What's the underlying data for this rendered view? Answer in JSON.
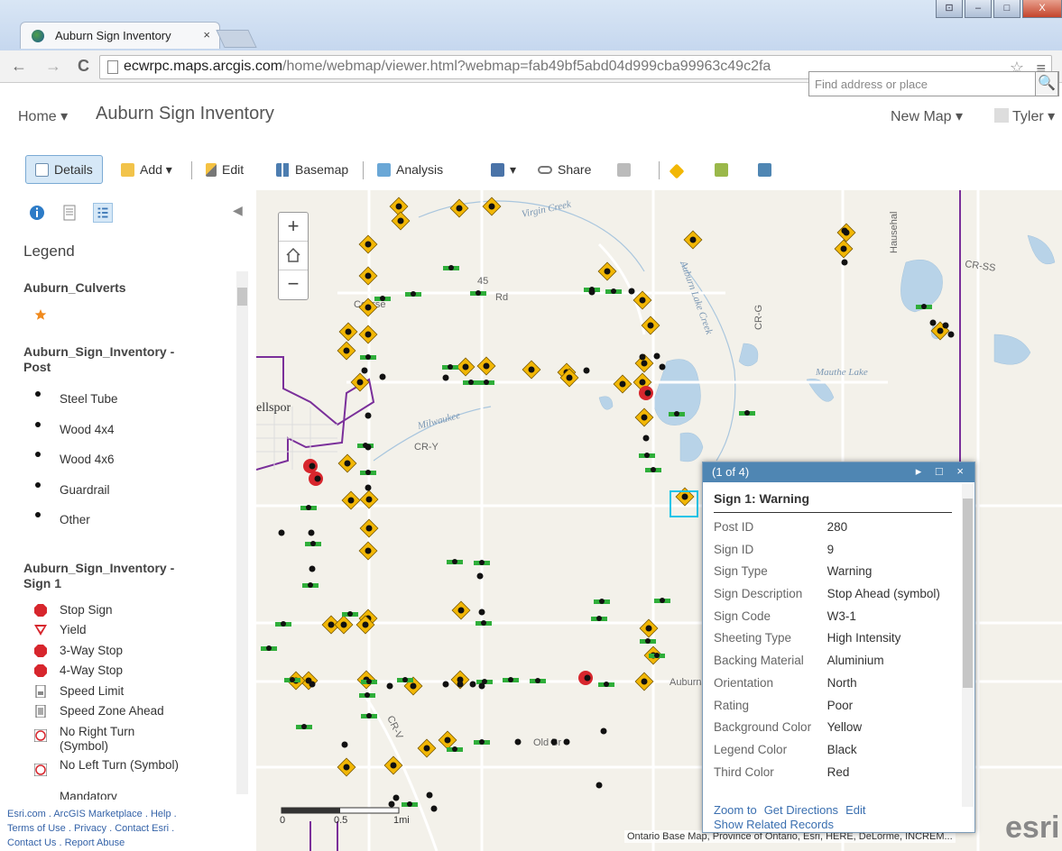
{
  "browser": {
    "tab_title": "Auburn Sign Inventory",
    "tab_close": "×",
    "url_host": "ecwrpc.maps.arcgis.com",
    "url_path": "/home/webmap/viewer.html?webmap=fab49bf5abd04d999cba99963c49c2fa",
    "back": "←",
    "forward": "→",
    "reload": "C",
    "star": "☆",
    "menu": "≡",
    "window_controls": [
      "⊡",
      "–",
      "□",
      "X"
    ]
  },
  "header": {
    "home_label": "Home ▾",
    "map_title": "Auburn Sign Inventory",
    "new_map_label": "New Map ▾",
    "user_label": "Tyler ▾"
  },
  "toolbar": {
    "details": "Details",
    "add": "Add ▾",
    "edit": "Edit",
    "basemap": "Basemap",
    "analysis": "Analysis",
    "save_caret": "▾",
    "share": "Share",
    "search_placeholder": "Find address or place",
    "search_button": "🔍"
  },
  "sidebar": {
    "collapse": "◀",
    "legend_title": "Legend",
    "layers": [
      {
        "name": "Auburn_Culverts",
        "items": [
          {
            "label": "",
            "symbol": "culvert-star"
          }
        ]
      },
      {
        "name": "Auburn_Sign_Inventory - Post",
        "items": [
          {
            "label": "Steel Tube",
            "symbol": "dot"
          },
          {
            "label": "Wood 4x4",
            "symbol": "dot"
          },
          {
            "label": "Wood 4x6",
            "symbol": "dot"
          },
          {
            "label": "Guardrail",
            "symbol": "dot"
          },
          {
            "label": "Other",
            "symbol": "dot"
          }
        ]
      },
      {
        "name": "Auburn_Sign_Inventory - Sign 1",
        "items": [
          {
            "label": "Stop Sign",
            "symbol": "stop"
          },
          {
            "label": "Yield",
            "symbol": "yield"
          },
          {
            "label": "3-Way Stop",
            "symbol": "stop"
          },
          {
            "label": "4-Way Stop",
            "symbol": "stop"
          },
          {
            "label": "Speed Limit",
            "symbol": "speed-limit"
          },
          {
            "label": "Speed Zone Ahead",
            "symbol": "speed-zone"
          },
          {
            "label": "No Right Turn (Symbol)",
            "symbol": "no-right-turn"
          },
          {
            "label": "No Left Turn (Symbol)",
            "symbol": "no-left-turn"
          },
          {
            "label": "Mandatory",
            "symbol": "mandatory"
          }
        ]
      }
    ],
    "footer": {
      "line1": [
        "Esri.com",
        "ArcGIS Marketplace",
        "Help"
      ],
      "line2": [
        "Terms of Use",
        "Privacy",
        "Contact Esri"
      ],
      "line3": [
        "Contact Us",
        "Report Abuse"
      ]
    }
  },
  "map": {
    "zoom_in": "+",
    "zoom_out": "−",
    "scale_labels": [
      "0",
      "0.5",
      "1mi"
    ],
    "attribution": "Ontario Base Map, Province of Ontario, Esri, HERE, DeLorme, INCREM...",
    "esri_logo": "esri",
    "place_labels": [
      "Virgin Creek",
      "Auburn Lake Creek",
      "Mauthe Lake",
      "ellspor",
      "CR-Y",
      "CR-G",
      "CR-SS",
      "CR-V",
      "Old Br",
      "Auburn",
      "Milwaukee",
      "45",
      "Rd",
      "Dr",
      "Hausehal",
      "Course"
    ]
  },
  "popup": {
    "counter": "(1 of 4)",
    "controls": "▸ □ ×",
    "title": "Sign 1: Warning",
    "fields": [
      {
        "key": "Post ID",
        "value": "280"
      },
      {
        "key": "Sign ID",
        "value": "9"
      },
      {
        "key": "Sign Type",
        "value": "Warning"
      },
      {
        "key": "Sign Description",
        "value": "Stop Ahead (symbol)"
      },
      {
        "key": "Sign Code",
        "value": "W3-1"
      },
      {
        "key": "Sheeting Type",
        "value": "High Intensity"
      },
      {
        "key": "Backing Material",
        "value": "Aluminium"
      },
      {
        "key": "Orientation",
        "value": "North"
      },
      {
        "key": "Rating",
        "value": "Poor"
      },
      {
        "key": "Background Color",
        "value": "Yellow"
      },
      {
        "key": "Legend Color",
        "value": "Black"
      },
      {
        "key": "Third Color",
        "value": "Red"
      }
    ],
    "links": [
      "Zoom to",
      "Get Directions",
      "Edit"
    ],
    "related": "Show Related Records"
  },
  "colors": {
    "accent": "#4f86b3",
    "sign_yellow": "#f2b705",
    "stop_red": "#d7262d",
    "boundary_purple": "#7a2f9a",
    "link": "#3563a8"
  }
}
